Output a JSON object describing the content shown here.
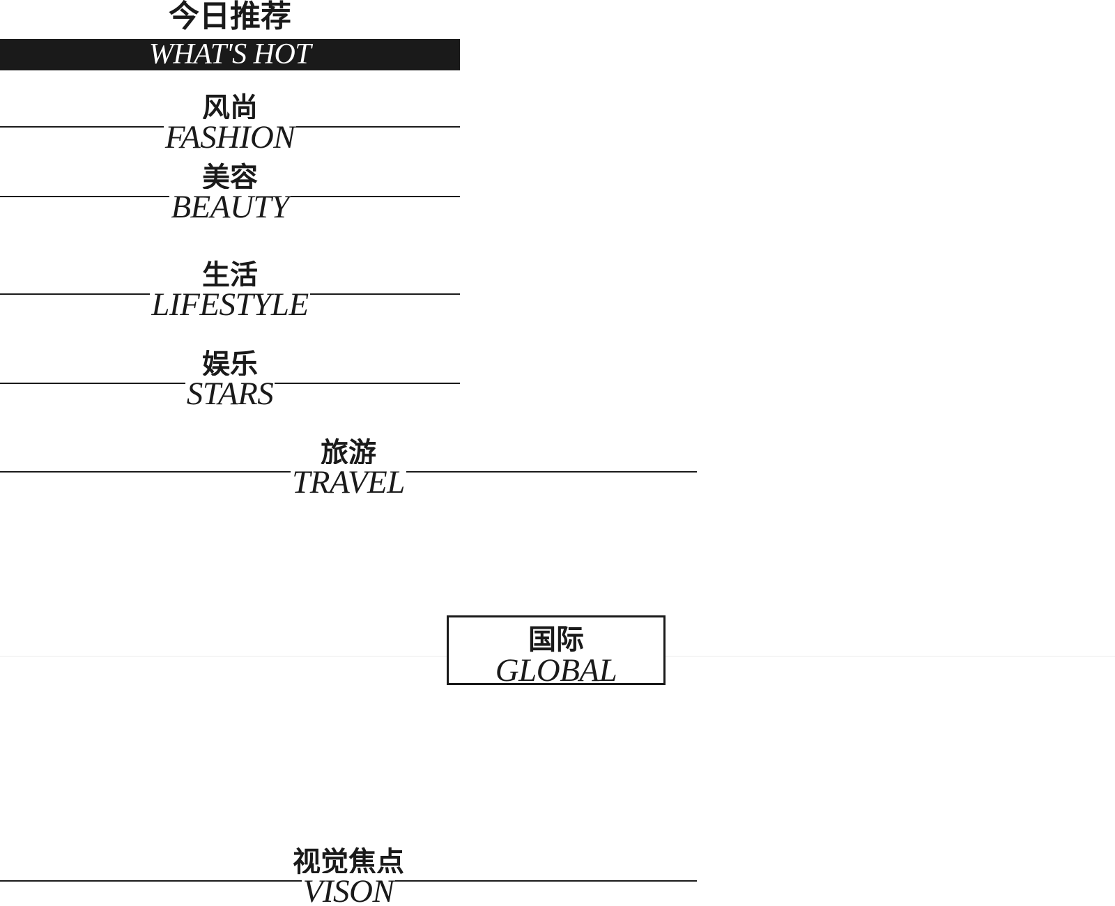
{
  "hot": {
    "cn": "今日推荐",
    "en": "WHAT'S HOT"
  },
  "sections": {
    "fashion": {
      "cn": "风尚",
      "en": "FASHION"
    },
    "beauty": {
      "cn": "美容",
      "en": "BEAUTY"
    },
    "lifestyle": {
      "cn": "生活",
      "en": "LIFESTYLE"
    },
    "stars": {
      "cn": "娱乐",
      "en": "STARS"
    },
    "travel": {
      "cn": "旅游",
      "en": "TRAVEL"
    },
    "vision": {
      "cn": "视觉焦点",
      "en": "VISON"
    }
  },
  "global": {
    "cn": "国际",
    "en": "GLOBAL"
  },
  "colors": {
    "ink": "#1a1a1a",
    "background": "#ffffff",
    "divider": "#ececec"
  }
}
